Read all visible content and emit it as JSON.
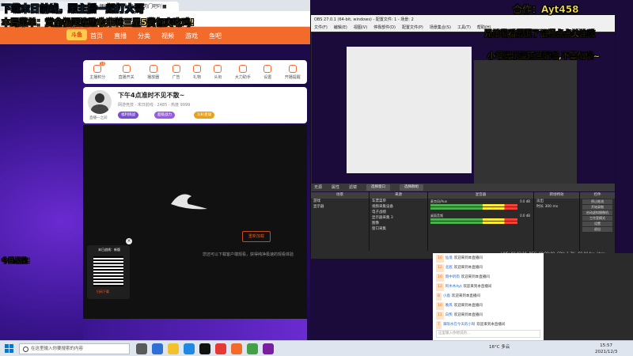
{
  "overlay": {
    "top_left": "下载末日前线，跟主播一起打大哥",
    "menu": "本局菜单：赏金极限连败收米转三星5费包爽吃鸡!",
    "collab": "合作：Ayt458",
    "follow": "兄弟萌看舒服了记得点点关注嗷",
    "promo": "小号娱乐整活直播嗷,不喜勿喷~",
    "record": "今日战绩："
  },
  "browser": {
    "tabs": [
      "斗鱼",
      "★偶搞·■图播上哥江的肉门吧吖■"
    ],
    "nav": [
      "首页",
      "直播",
      "分类",
      "视频",
      "游戏",
      "鱼吧"
    ],
    "logo": "斗鱼"
  },
  "features": [
    {
      "label": "主播积分",
      "badge": "10"
    },
    {
      "label": "直播开关",
      "badge": ""
    },
    {
      "label": "播放器",
      "badge": ""
    },
    {
      "label": "广告",
      "badge": ""
    },
    {
      "label": "礼物",
      "badge": ""
    },
    {
      "label": "头衔",
      "badge": ""
    },
    {
      "label": "大力助手",
      "badge": ""
    },
    {
      "label": "设置",
      "badge": ""
    },
    {
      "label": "开播提醒",
      "badge": ""
    }
  ],
  "streamer": {
    "title": "下午4点准时不见不散~",
    "name": "直播一之间",
    "meta": "网游竞技 · 末日前线 · 2485 · 热度 9999",
    "pills": [
      "福利挑战",
      "超级战力",
      "1(8)星级"
    ]
  },
  "video": {
    "button": "重新加载",
    "hint": "您还可以下载客户端观看，获得纯净极速的观看体验"
  },
  "qr": {
    "title": "末日战线：新版",
    "caption": "扫码下载"
  },
  "obs": {
    "title": "OBS 27.0.1 (64-bit, windows) - 配置文件: 1 - 场景: 2",
    "menu": [
      "文件(F)",
      "编辑(E)",
      "视图(V)",
      "停靠部件(D)",
      "配置文件(P)",
      "场景集合(S)",
      "工具(T)",
      "帮助(H)"
    ],
    "dock_header": [
      "无源",
      "属性",
      "滤镜",
      "选择窗口",
      "选择群组"
    ],
    "scenes_title": "场景",
    "scenes": [
      "游戏",
      "显示器"
    ],
    "sources_title": "来源",
    "sources": [
      "车票菜单",
      "视频采集设备",
      "电子战绩",
      "显示器采集 3",
      "图像",
      "窗口采集"
    ],
    "mixer_title": "混音器",
    "mixer": [
      {
        "name": "麦克风/Aux",
        "db": "0.0 dB"
      },
      {
        "name": "桌面音频",
        "db": "0.0 dB"
      }
    ],
    "transitions_title": "转场特效",
    "transition_label": "淡出",
    "duration_label": "时长",
    "duration_value": "300 ms",
    "controls_title": "控件",
    "controls": [
      "停止推流",
      "开始录制",
      "启动虚拟摄像机",
      "工作室模式",
      "设置",
      "退出"
    ],
    "status": [
      "LIVE: 01:43:16",
      "REC: 00:00:00",
      "CPU: 1.7%, 60.00 fps",
      "kb/s: 2551"
    ]
  },
  "chat": {
    "rows": [
      {
        "badge": "10",
        "user": "仙境",
        "text": "欢迎来到本直播间"
      },
      {
        "badge": "12",
        "user": "北宸",
        "text": "欢迎来到本直播间"
      },
      {
        "badge": "10",
        "user": "雨中听雨",
        "text": "欢迎来到本直播间"
      },
      {
        "badge": "13",
        "user": "阿木木Ayt",
        "text": "欢迎来到本直播间"
      },
      {
        "badge": "8",
        "user": "小鹿",
        "text": "欢迎来到本直播间"
      },
      {
        "badge": "10",
        "user": "晚风",
        "text": "欢迎来到本直播间"
      },
      {
        "badge": "11",
        "user": "白熊",
        "text": "欢迎来到本直播间"
      },
      {
        "badge": "7",
        "user": "来呀水在今天的小呀",
        "text": "欢迎来到本直播间"
      }
    ],
    "input_placeholder": "这里输入你想说的..."
  },
  "taskbar": {
    "search_placeholder": "在这里输入你要搜索的内容",
    "tray": "16°C 多云",
    "time": "15:57",
    "date": "2021/12/3"
  }
}
